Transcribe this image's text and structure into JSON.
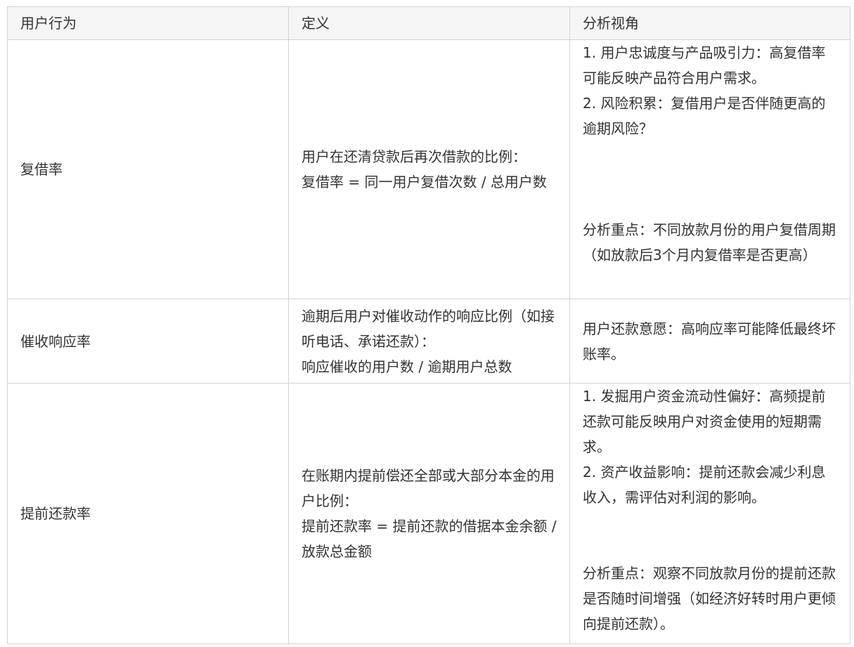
{
  "table": {
    "headers": [
      "用户行为",
      "定义",
      "分析视角"
    ],
    "rows": [
      {
        "behavior": "复借率",
        "definition": [
          "用户在还清贷款后再次借款的比例：",
          "复借率 = 同一用户复借次数 / 总用户数"
        ],
        "analysis_points": [
          "1. 用户忠诚度与产品吸引力：高复借率可能反映产品符合用户需求。",
          "2. 风险积累：复借用户是否伴随更高的逾期风险？"
        ],
        "analysis_focus": "分析重点：不同放款月份的用户复借周期（如放款后3个月内复借率是否更高）"
      },
      {
        "behavior": "催收响应率",
        "definition": [
          "逾期后用户对催收动作的响应比例（如接听电话、承诺还款）：",
          "响应催收的用户数 / 逾期用户总数"
        ],
        "analysis_points": [
          "用户还款意愿：高响应率可能降低最终坏账率。"
        ],
        "analysis_focus": ""
      },
      {
        "behavior": "提前还款率",
        "definition": [
          "在账期内提前偿还全部或大部分本金的用户比例：",
          "提前还款率 = 提前还款的借据本金余额 / 放款总金额"
        ],
        "analysis_points": [
          "1. 发掘用户资金流动性偏好：高频提前还款可能反映用户对资金使用的短期需求。",
          "2. 资产收益影响：提前还款会减少利息收入，需评估对利润的影响。"
        ],
        "analysis_focus": "分析重点：观察不同放款月份的提前还款是否随时间增强（如经济好转时用户更倾向提前还款）。"
      }
    ]
  }
}
